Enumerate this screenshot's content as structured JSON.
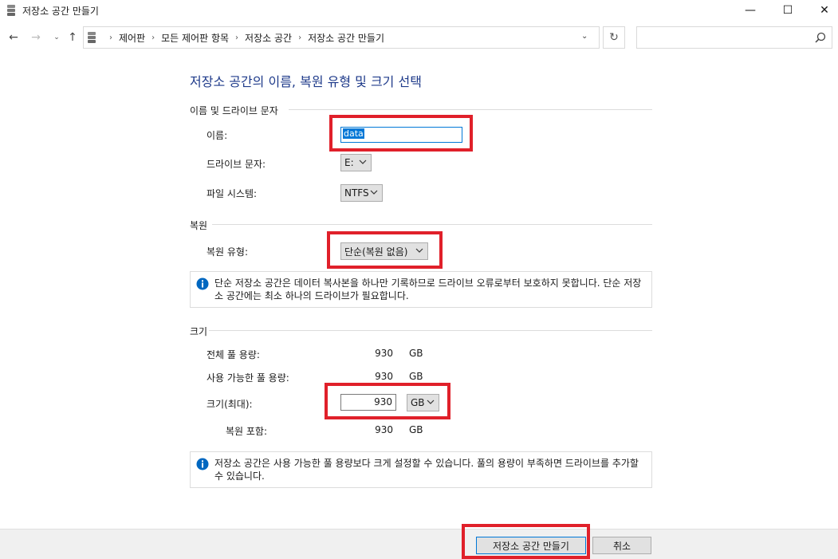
{
  "window": {
    "title": "저장소 공간 만들기",
    "minimize": "—",
    "maximize": "☐",
    "close": "✕"
  },
  "nav": {
    "back": "←",
    "forward": "→",
    "recent": "⌄",
    "up": "↑",
    "refresh": "↻",
    "breadcrumb_sep": "›",
    "breadcrumbs": [
      "제어판",
      "모든 제어판 항목",
      "저장소 공간",
      "저장소 공간 만들기"
    ],
    "search_placeholder": ""
  },
  "heading": "저장소 공간의 이름, 복원 유형 및 크기 선택",
  "name_section": {
    "title": "이름 및 드라이브 문자",
    "name_label": "이름:",
    "name_value": "data",
    "drive_label": "드라이브 문자:",
    "drive_value": "E:",
    "fs_label": "파일 시스템:",
    "fs_value": "NTFS"
  },
  "resiliency_section": {
    "title": "복원",
    "type_label": "복원 유형:",
    "type_value": "단순(복원 없음)",
    "info": "단순 저장소 공간은 데이터 복사본을 하나만 기록하므로 드라이브 오류로부터 보호하지 못합니다. 단순 저장소 공간에는 최소 하나의 드라이브가 필요합니다."
  },
  "size_section": {
    "title": "크기",
    "total_label": "전체 풀 용량:",
    "total_value": "930",
    "total_unit": "GB",
    "available_label": "사용 가능한 풀 용량:",
    "available_value": "930",
    "available_unit": "GB",
    "max_label": "크기(최대):",
    "max_value": "930",
    "max_unit": "GB",
    "incl_label": "복원 포함:",
    "incl_value": "930",
    "incl_unit": "GB",
    "info": "저장소 공간은 사용 가능한 풀 용량보다 크게 설정할 수 있습니다. 풀의 용량이 부족하면 드라이브를 추가할 수 있습니다."
  },
  "footer": {
    "create_label": "저장소 공간 만들기",
    "cancel_label": "취소"
  },
  "colors": {
    "accent": "#0078d7",
    "heading": "#1e3a8a",
    "highlight": "#e0202a"
  }
}
